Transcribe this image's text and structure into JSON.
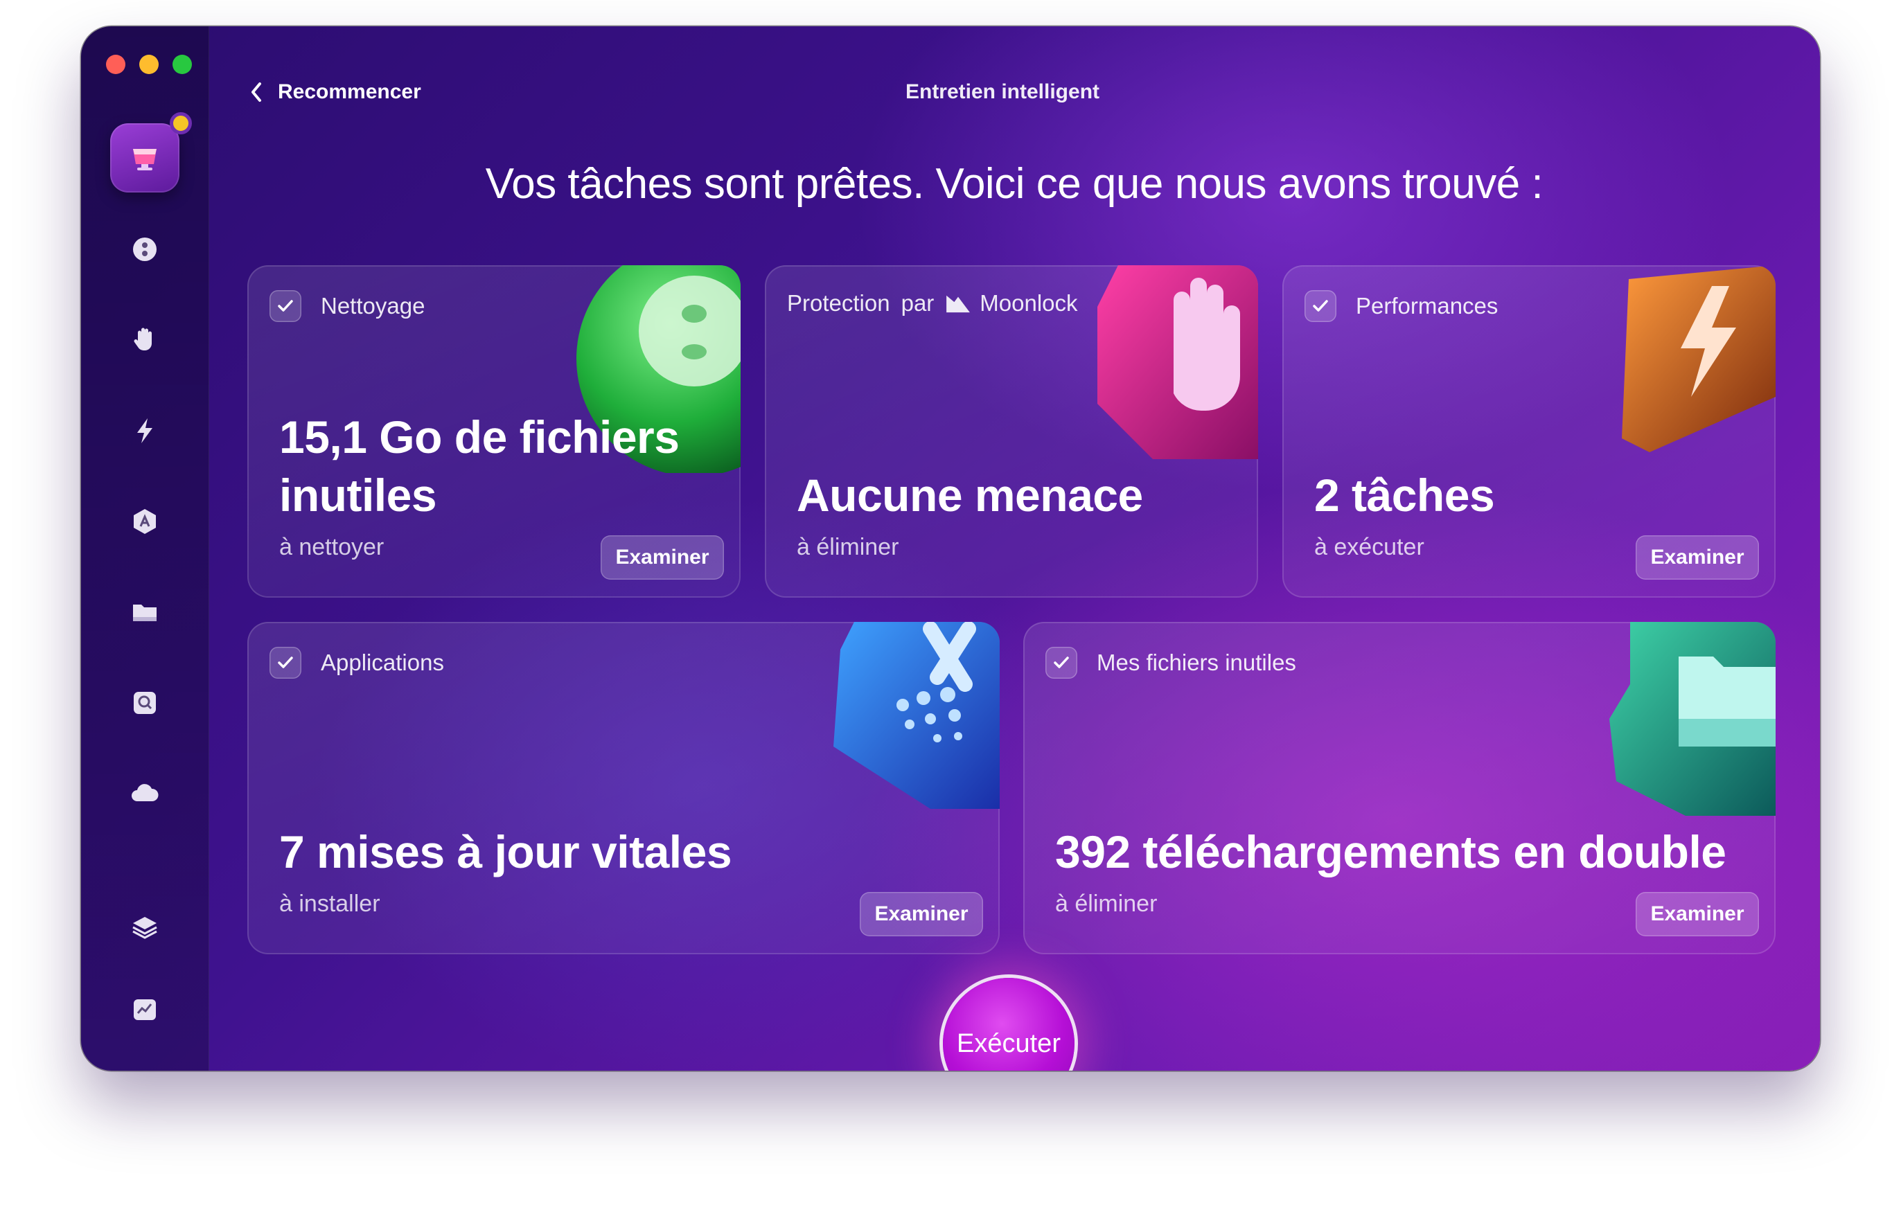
{
  "window": {
    "title": "Entretien intelligent",
    "back_label": "Recommencer"
  },
  "headline": "Vos tâches sont prêtes. Voici ce que nous avons trouvé :",
  "sidebar": {
    "items": [
      {
        "icon": "smart-care-icon",
        "active": true,
        "has_badge": true
      },
      {
        "icon": "cleanup-icon"
      },
      {
        "icon": "protection-hand-icon"
      },
      {
        "icon": "performance-bolt-icon"
      },
      {
        "icon": "applications-icon"
      },
      {
        "icon": "my-clutter-folder-icon"
      },
      {
        "icon": "space-lens-icon"
      },
      {
        "icon": "cloud-cleanup-icon"
      },
      {
        "icon": "assistant-stack-icon"
      },
      {
        "icon": "menu-app-icon"
      }
    ]
  },
  "cards": {
    "cleanup": {
      "category": "Nettoyage",
      "value_line1": "15,1 Go de fichiers",
      "value_line2": "inutiles",
      "sub": "à nettoyer",
      "button": "Examiner"
    },
    "protection": {
      "category_prefix": "Protection",
      "category_by": "par",
      "brand": "Moonlock",
      "value": "Aucune menace",
      "sub": "à éliminer"
    },
    "performance": {
      "category": "Performances",
      "value": "2 tâches",
      "sub": "à exécuter",
      "button": "Examiner"
    },
    "applications": {
      "category": "Applications",
      "value": "7 mises à jour vitales",
      "sub": "à installer",
      "button": "Examiner"
    },
    "clutter": {
      "category": "Mes fichiers inutiles",
      "value": "392 téléchargements en double",
      "sub": "à éliminer",
      "button": "Examiner"
    }
  },
  "run_button": "Exécuter",
  "colors": {
    "accent": "#b50fd6",
    "badge": "#f5c527",
    "traffic_red": "#ff5f57",
    "traffic_yellow": "#febc2e",
    "traffic_green": "#28c840"
  }
}
